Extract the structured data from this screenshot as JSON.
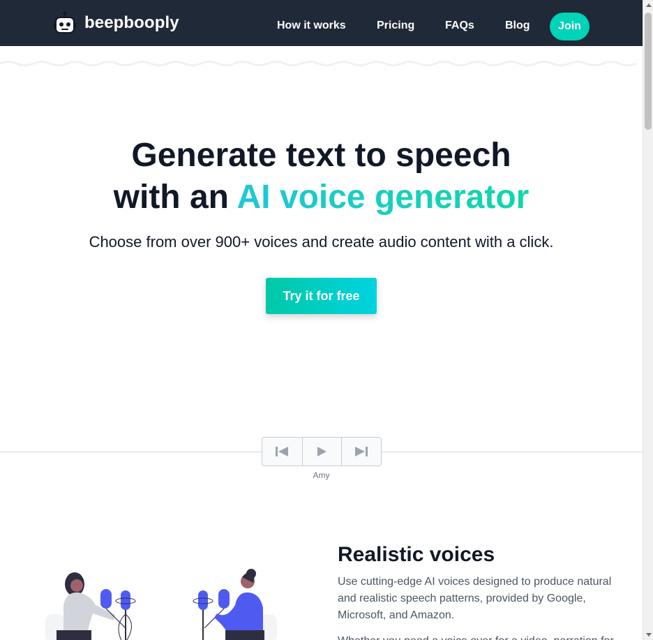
{
  "header": {
    "brand": "beepbooply",
    "nav": [
      "How it works",
      "Pricing",
      "FAQs",
      "Blog"
    ],
    "join_label": "Join"
  },
  "hero": {
    "title_line1": "Generate text to speech",
    "title_line2_plain": "with an ",
    "title_line2_accent": "AI voice generator",
    "subtitle": "Choose from over 900+ voices and create audio content with a click.",
    "cta_label": "Try it for free"
  },
  "player": {
    "voice_name": "Amy"
  },
  "feature": {
    "title": "Realistic voices",
    "text": "Use cutting-edge AI voices designed to produce natural and realistic speech patterns, provided by Google, Microsoft, and Amazon.",
    "text2_partial": "Whether you need a voice over for a video, narration for"
  },
  "colors": {
    "header_bg": "#1f2937",
    "accent": "#00d3b7",
    "illustration_blue": "#4f5bf0"
  },
  "icons": [
    "robot-logo-icon",
    "skip-back-icon",
    "play-icon",
    "skip-forward-icon"
  ]
}
